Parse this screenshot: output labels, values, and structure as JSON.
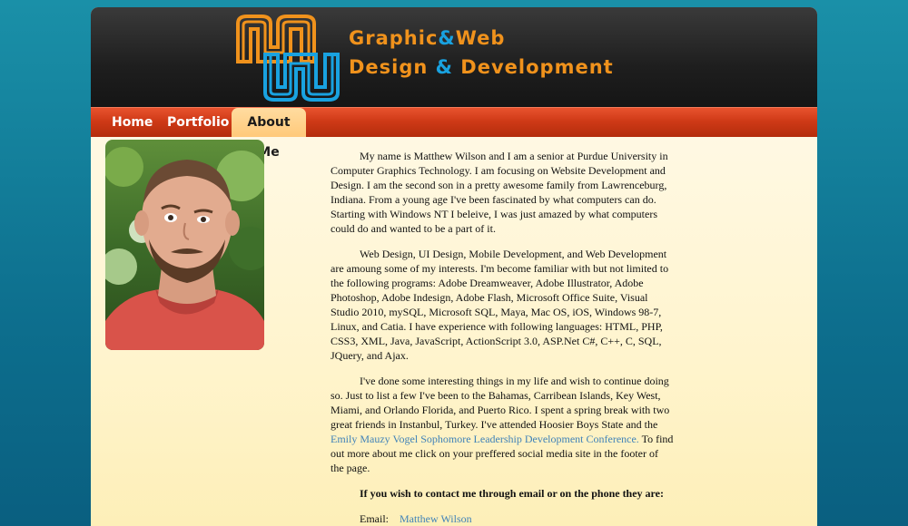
{
  "site": {
    "logo_line1_a": "Graphic",
    "logo_line1_amp": "&",
    "logo_line1_b": "Web",
    "logo_line2_a": "Design ",
    "logo_line2_amp": "&",
    "logo_line2_b": " Development"
  },
  "nav": {
    "home": "Home",
    "portfolio": "Portfolio",
    "about": "About Me"
  },
  "content": {
    "p1": "My name is Matthew Wilson and I am a senior at Purdue University in Computer Graphics Technology. I am focusing on Website Development and Design. I am the second son in a pretty awesome family from Lawrenceburg, Indiana. From a young age I've been fascinated by what computers can do. Starting with Windows NT I beleive, I was just amazed by what computers could do and wanted to be a part of it.",
    "p2": "Web Design, UI Design, Mobile Development, and Web Development are amoung some of my interests. I'm become familiar with but not limited to the following programs: Adobe Dreamweaver, Adobe Illustrator, Adobe Photoshop, Adobe Indesign, Adobe Flash, Microsoft Office Suite, Visual Studio 2010, mySQL, Microsoft SQL, Maya, Mac OS, iOS, Windows 98-7, Linux, and Catia. I have experience with following languages: HTML, PHP, CSS3, XML, Java, JavaScript, ActionScript 3.0, ASP.Net C#, C++, C, SQL, JQuery, and Ajax.",
    "p3_pre": "I've done some interesting things in my life and wish to continue doing so. Just to list a few I've been to the Bahamas, Carribean Islands, Key West, Miami, and Orlando Florida, and Puerto Rico. I spent a spring break with two great friends in Instanbul, Turkey. I've attended Hoosier Boys State and the ",
    "p3_link": "Emily Mauzy Vogel Sophomore Leadership Development Conference.",
    "p3_post": " To find out more about me click on your preffered social media site in the footer of the page.",
    "contact_heading": "If you wish to contact me through email or on the phone they are:",
    "email_label": "Email:",
    "email_link": "Matthew Wilson"
  },
  "colors": {
    "logo_orange": "#f0921c",
    "logo_blue": "#19a2e0",
    "nav_red": "#cf3a17",
    "link": "#3f82b8"
  }
}
